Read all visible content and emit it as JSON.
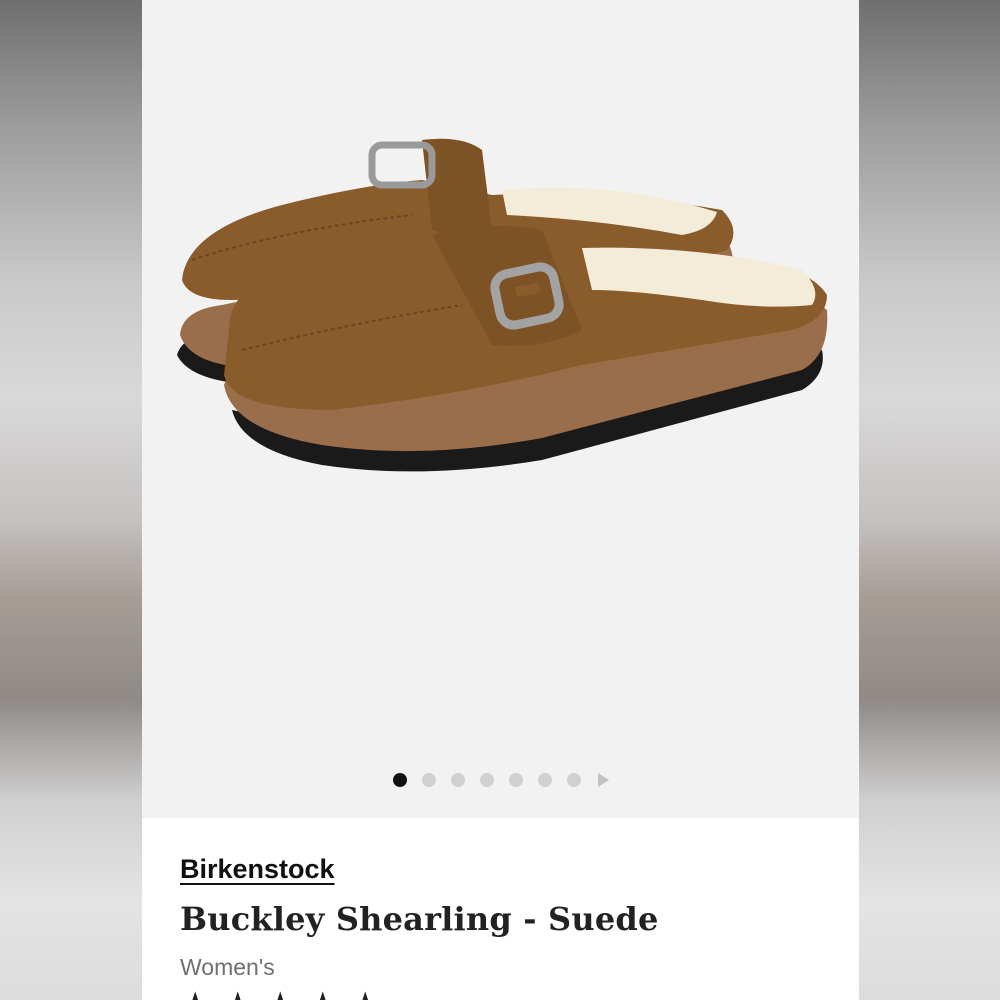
{
  "product": {
    "brand": "Birkenstock",
    "name": "Buckley Shearling - Suede",
    "gender": "Women's"
  },
  "gallery": {
    "image_count": 7,
    "active_index": 0,
    "next_icon": "next-arrow-icon"
  },
  "rating": {
    "icon": "star-icon",
    "stars_shown": 5
  },
  "colors": {
    "suede": "#8a5c2c",
    "shearling": "#f3ecd9",
    "cork_sole": "#9a6e4a",
    "outsole": "#1a1a1a",
    "gallery_bg": "#f2f2f2",
    "active_dot": "#111111",
    "inactive_dot": "#d0d0d0"
  }
}
